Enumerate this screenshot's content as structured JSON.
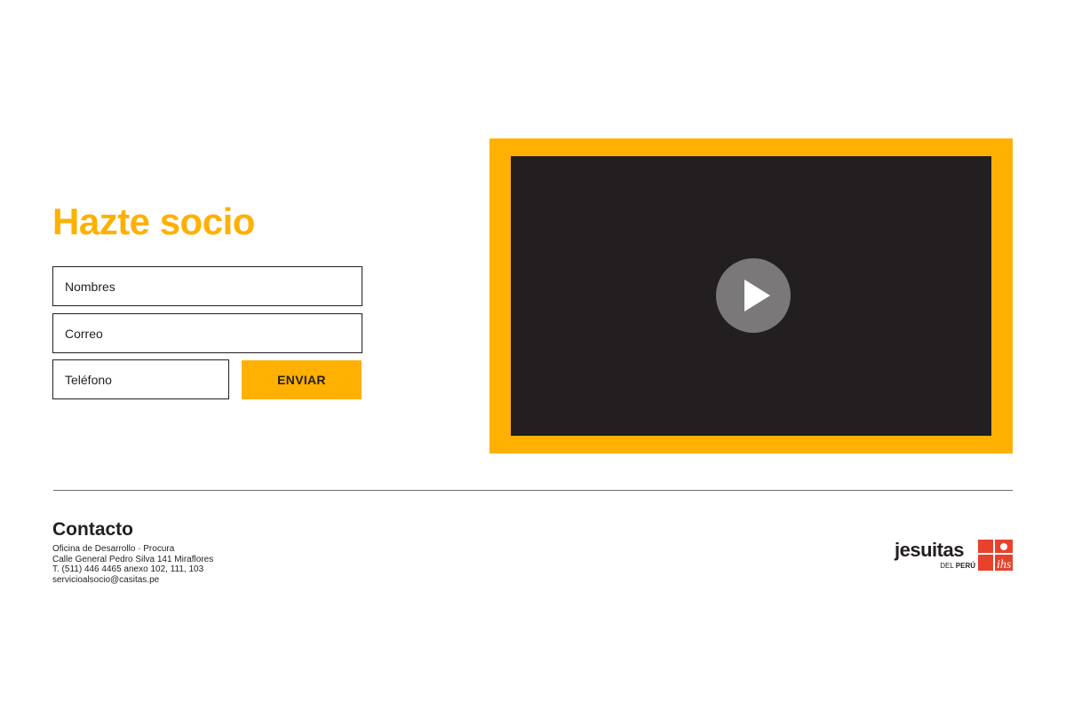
{
  "signup": {
    "title": "Hazte socio",
    "fields": {
      "nombres_placeholder": "Nombres",
      "correo_placeholder": "Correo",
      "telefono_placeholder": "Teléfono"
    },
    "submit_label": "ENVIAR"
  },
  "video": {
    "play_icon": "play-icon"
  },
  "contact": {
    "title": "Contacto",
    "lines": [
      "Oficina de Desarrollo · Procura",
      "Calle General Pedro Silva 141 Miraflores",
      "T. (511) 446 4465 anexo 102, 111, 103",
      "servicioalsocio@casitas.pe"
    ]
  },
  "logo": {
    "word": "jesuitas",
    "sub_prefix": "DEL",
    "sub_bold": "PERÚ",
    "mark_text": "ihs"
  },
  "colors": {
    "accent": "#ffb000",
    "video_screen": "#231f20",
    "play_circle": "#7a7878",
    "logo_red": "#e8412c",
    "text": "#231f20"
  }
}
